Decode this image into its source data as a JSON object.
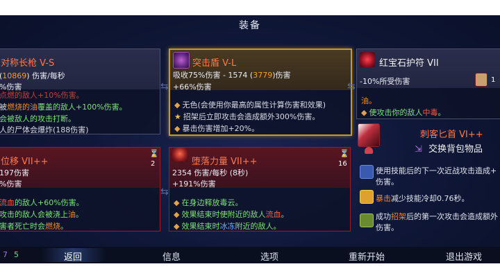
{
  "screen_title": "装备",
  "cards": {
    "c1": {
      "name": "对称长枪 V-S",
      "line1_pre": "(",
      "line1_num": "10869",
      "line1_post": ") 伤害/每秒",
      "line2": "%伤害",
      "effects": [
        {
          "prefix": "",
          "text": "点燃的敌人+10%伤害。"
        },
        {
          "prefix": "被",
          "hl": "燃烧的油",
          "hl_class": "orange",
          "post": "覆盖的敌人+100%伤害。"
        },
        {
          "prefix": "会被敌人的攻击打断。"
        },
        {
          "prefix": "人的尸体会爆炸(188伤害)"
        }
      ]
    },
    "c2": {
      "name": "突击盾 V-L",
      "line1": "吸收75%伤害 - 1574 (",
      "line1_num": "3779",
      "line1_post": ")伤害",
      "line2": "+66%伤害",
      "effects": [
        {
          "text": "无色(会使用你最高的属性计算伤害和效果)"
        },
        {
          "text": "招架后立即攻击会造成额外300%伤害。"
        },
        {
          "text": "暴击伤害增加+20%。"
        }
      ]
    },
    "c3": {
      "name": "红宝石护符 VII",
      "line1": "-10%所受伤害",
      "count": "1",
      "effects": [
        {
          "text": "油。",
          "cls": "orange"
        },
        {
          "pre": "使攻击你的敌人",
          "hl": "中毒",
          "post": "。"
        }
      ]
    },
    "c4": {
      "name": "位移 VII++",
      "hourglass": "2",
      "line1": "197伤害",
      "line2": "%伤害",
      "effects": [
        {
          "pre": "",
          "hl": "流血",
          "hl_class": "red",
          "post": "的敌人+60%伤害。"
        },
        {
          "pre": "攻击的敌人会被浇上",
          "hl": "油",
          "hl_class": "orange",
          "post": "。"
        },
        {
          "pre": "害者死亡时会",
          "hl": "燃烧",
          "hl_class": "orange",
          "post": "。"
        }
      ]
    },
    "c5": {
      "name": "堕落力量 VII++",
      "hourglass": "16",
      "line1": "2354 伤害/每秒 (8秒)",
      "line2": "+191%伤害",
      "effects": [
        {
          "text": "在身边释放毒云。"
        },
        {
          "pre": "效果结束时使附近的敌人",
          "hl": "流血",
          "hl_class": "red",
          "post": "。"
        },
        {
          "pre": "效果结束时",
          "hl": "冰冻",
          "hl_class": "blue",
          "post": "附近的敌人。"
        }
      ]
    },
    "c6": {
      "name": "刺客匕首 VI++",
      "swap_label": "交换背包物品",
      "rows": [
        {
          "text": "使用技能后的下一次近战攻击造成+",
          "line2": "伤害。"
        },
        {
          "hl": "暴击",
          "post": "减少技能冷却0.76秒。"
        },
        {
          "pre": "成功",
          "hl": "招架",
          "post": "后的第一次攻击会造成额外",
          "line2": "伤害。"
        }
      ]
    }
  },
  "bottom_bar": {
    "version_a": "7",
    "version_b": "5",
    "buttons": [
      "返回",
      "信息",
      "选项",
      "重新开始",
      "退出游戏"
    ],
    "selected": "返回"
  },
  "colors": {
    "name_orange": "#ff7a4a",
    "stat_orange": "#f4a11b",
    "gold_border": "#c49a2c"
  }
}
